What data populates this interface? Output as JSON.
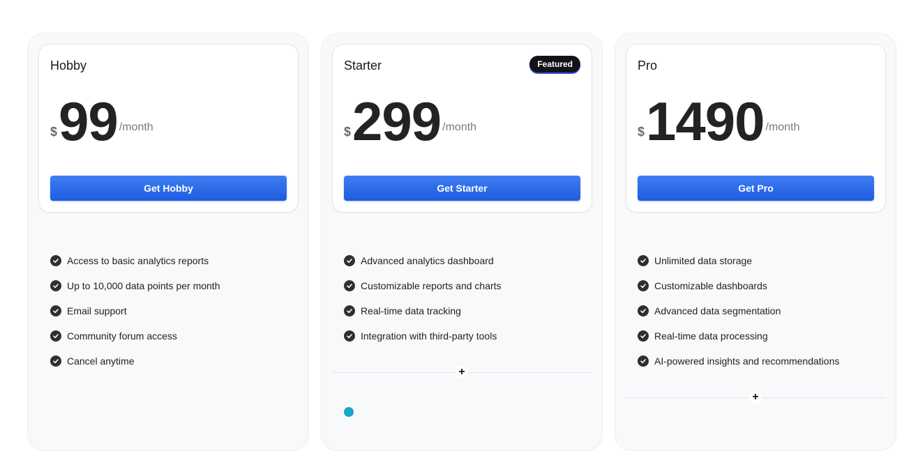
{
  "plans": [
    {
      "name": "Hobby",
      "currency": "$",
      "price": "99",
      "period": "/month",
      "cta": "Get Hobby",
      "features": [
        "Access to basic analytics reports",
        "Up to 10,000 data points per month",
        "Email support",
        "Community forum access",
        "Cancel anytime"
      ]
    },
    {
      "name": "Starter",
      "badge": "Featured",
      "currency": "$",
      "price": "299",
      "period": "/month",
      "cta": "Get Starter",
      "features": [
        "Advanced analytics dashboard",
        "Customizable reports and charts",
        "Real-time data tracking",
        "Integration with third-party tools"
      ],
      "divider_icon": "plus-icon"
    },
    {
      "name": "Pro",
      "currency": "$",
      "price": "1490",
      "period": "/month",
      "cta": "Get Pro",
      "features": [
        "Unlimited data storage",
        "Customizable dashboards",
        "Advanced data segmentation",
        "Real-time data processing",
        "AI-powered insights and recommendations"
      ],
      "divider_icon": "plus-icon"
    }
  ],
  "colors": {
    "accent": "#1d5ce0",
    "badge_bg": "#111318",
    "column_bg": "#f8f9fb"
  }
}
